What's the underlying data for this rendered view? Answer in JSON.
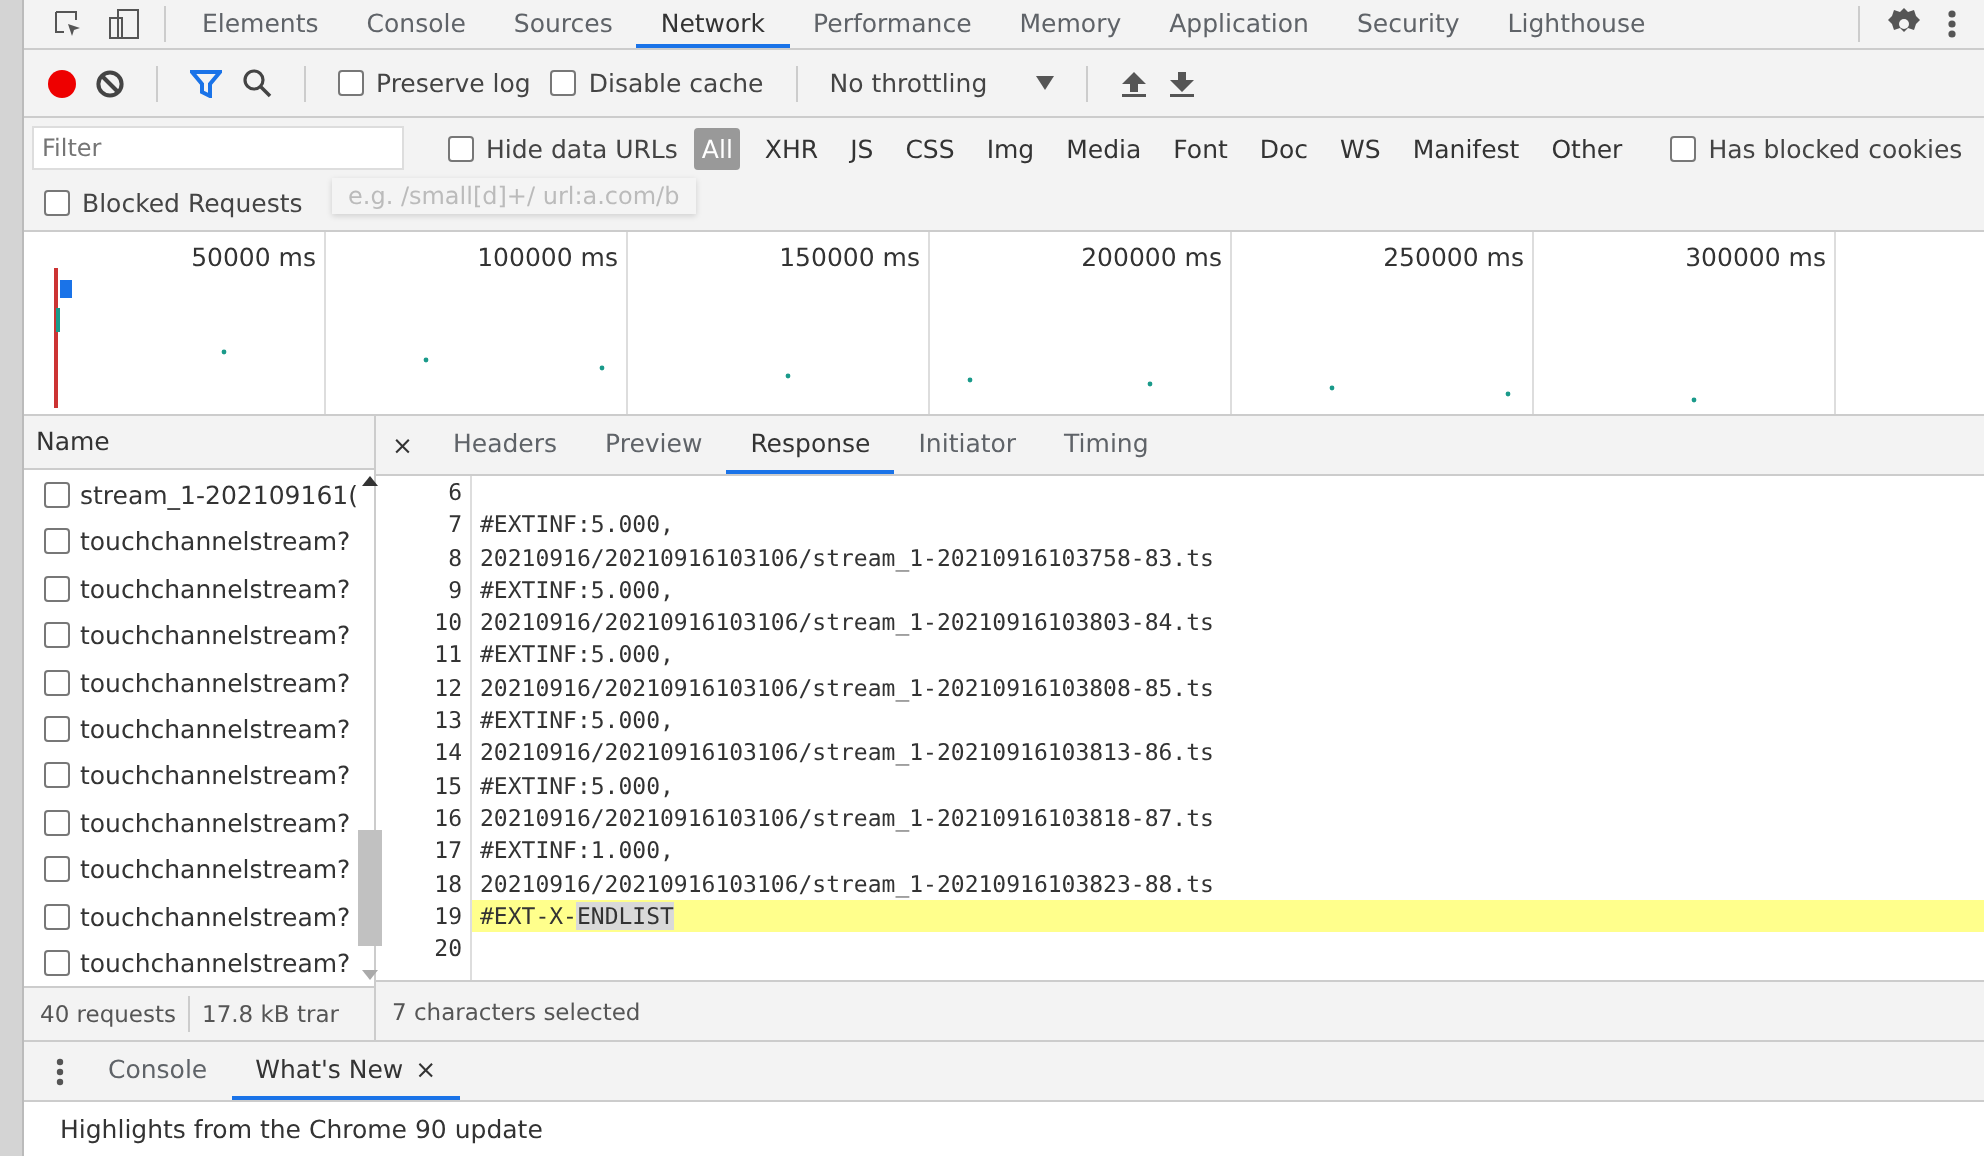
{
  "main_tabs": [
    {
      "label": "Elements",
      "selected": false
    },
    {
      "label": "Console",
      "selected": false
    },
    {
      "label": "Sources",
      "selected": false
    },
    {
      "label": "Network",
      "selected": true
    },
    {
      "label": "Performance",
      "selected": false
    },
    {
      "label": "Memory",
      "selected": false
    },
    {
      "label": "Application",
      "selected": false
    },
    {
      "label": "Security",
      "selected": false
    },
    {
      "label": "Lighthouse",
      "selected": false
    }
  ],
  "toolbar": {
    "recording": true,
    "filter_active": true,
    "checkboxes": [
      {
        "label": "Preserve log",
        "checked": false
      },
      {
        "label": "Disable cache",
        "checked": false
      }
    ],
    "throttling": "No throttling"
  },
  "filter": {
    "placeholder": "Filter",
    "hide_data_urls": {
      "label": "Hide data URLs",
      "checked": false
    },
    "types": [
      {
        "label": "All",
        "selected": true
      },
      {
        "label": "XHR",
        "selected": false
      },
      {
        "label": "JS",
        "selected": false
      },
      {
        "label": "CSS",
        "selected": false
      },
      {
        "label": "Img",
        "selected": false
      },
      {
        "label": "Media",
        "selected": false
      },
      {
        "label": "Font",
        "selected": false
      },
      {
        "label": "Doc",
        "selected": false
      },
      {
        "label": "WS",
        "selected": false
      },
      {
        "label": "Manifest",
        "selected": false
      },
      {
        "label": "Other",
        "selected": false
      }
    ],
    "blocked_cookies": {
      "label": "Has blocked cookies",
      "checked": false
    },
    "blocked_requests": {
      "label": "Blocked Requests",
      "checked": false
    },
    "tooltip": "e.g. /small[d]+/ url:a.com/b"
  },
  "timeline": {
    "ticks": [
      "50000 ms",
      "100000 ms",
      "150000 ms",
      "200000 ms",
      "250000 ms",
      "300000 ms"
    ]
  },
  "requests": {
    "column": "Name",
    "rows": [
      {
        "name": "stream_1-202109161(",
        "selected": false
      },
      {
        "name": "touchchannelstream?",
        "selected": false
      },
      {
        "name": "touchchannelstream?",
        "selected": false
      },
      {
        "name": "touchchannelstream?",
        "selected": false
      },
      {
        "name": "touchchannelstream?",
        "selected": false
      },
      {
        "name": "touchchannelstream?",
        "selected": false
      },
      {
        "name": "touchchannelstream?",
        "selected": false
      },
      {
        "name": "touchchannelstream?",
        "selected": false
      },
      {
        "name": "touchchannelstream?",
        "selected": false
      },
      {
        "name": "touchchannelstream?",
        "selected": false
      },
      {
        "name": "touchchannelstream?",
        "selected": false
      }
    ],
    "status": [
      "40 requests",
      "17.8 kB trar"
    ]
  },
  "detail": {
    "close": "×",
    "tabs": [
      {
        "label": "Headers",
        "selected": false
      },
      {
        "label": "Preview",
        "selected": false
      },
      {
        "label": "Response",
        "selected": true
      },
      {
        "label": "Initiator",
        "selected": false
      },
      {
        "label": "Timing",
        "selected": false
      }
    ],
    "lines": [
      {
        "num": "6",
        "highlighted": false
      },
      {
        "num": "7",
        "text": "#EXTINF:5.000,",
        "highlighted": false
      },
      {
        "num": "8",
        "text": "20210916/20210916103106/stream_1-20210916103758-83.ts",
        "highlighted": false
      },
      {
        "num": "9",
        "text": "#EXTINF:5.000,",
        "highlighted": false
      },
      {
        "num": "10",
        "text": "20210916/20210916103106/stream_1-20210916103803-84.ts",
        "highlighted": false
      },
      {
        "num": "11",
        "text": "#EXTINF:5.000,",
        "highlighted": false
      },
      {
        "num": "12",
        "text": "20210916/20210916103106/stream_1-20210916103808-85.ts",
        "highlighted": false
      },
      {
        "num": "13",
        "text": "#EXTINF:5.000,",
        "highlighted": false
      },
      {
        "num": "14",
        "text": "20210916/20210916103106/stream_1-20210916103813-86.ts",
        "highlighted": false
      },
      {
        "num": "15",
        "text": "#EXTINF:5.000,",
        "highlighted": false
      },
      {
        "num": "16",
        "text": "20210916/20210916103106/stream_1-20210916103818-87.ts",
        "highlighted": false
      },
      {
        "num": "17",
        "text": "#EXTINF:1.000,",
        "highlighted": false
      },
      {
        "num": "18",
        "text": "20210916/20210916103106/stream_1-20210916103823-88.ts",
        "highlighted": false
      },
      {
        "num": "19",
        "text": "#EXT-X-",
        "selected_text": "ENDLIST",
        "highlighted": true
      },
      {
        "num": "20",
        "highlighted": false
      }
    ],
    "status": "7 characters selected"
  },
  "drawer": {
    "tabs": [
      {
        "label": "Console",
        "selected": false,
        "closable": false
      },
      {
        "label": "What's New",
        "selected": true,
        "closable": true
      }
    ],
    "close": "×",
    "content": "Highlights from the Chrome 90 update"
  }
}
